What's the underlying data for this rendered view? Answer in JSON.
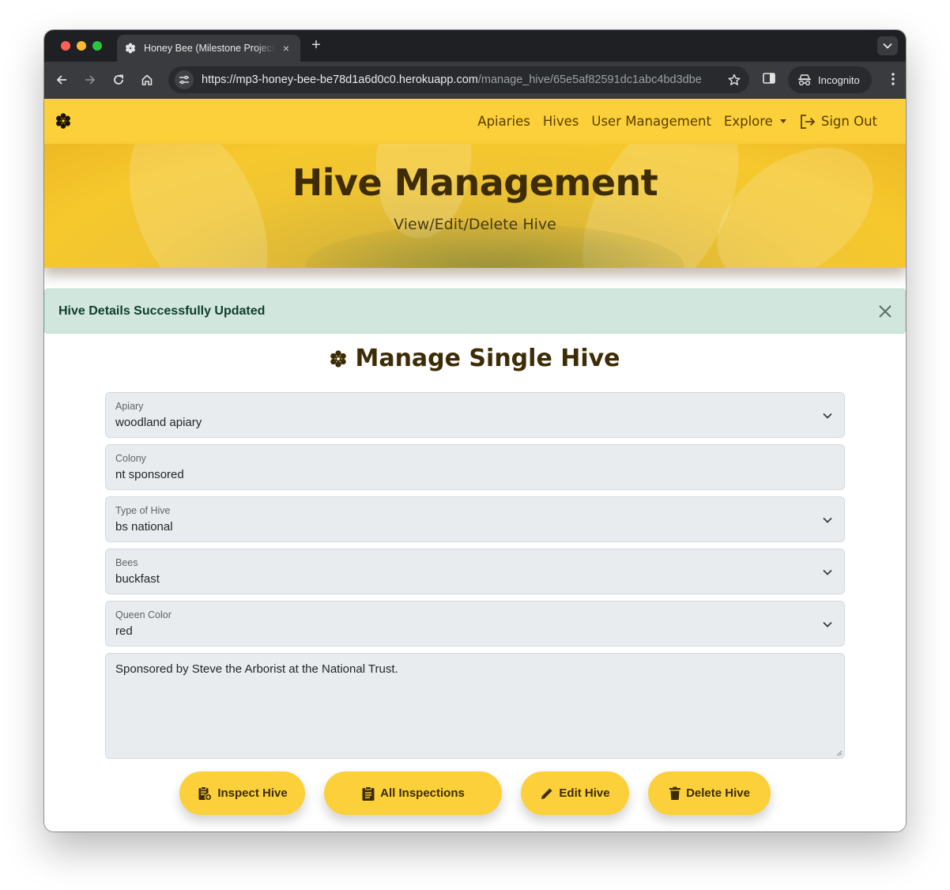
{
  "browser": {
    "tab_title": "Honey Bee (Milestone Project 3)",
    "tab_close": "×",
    "new_tab": "+",
    "url_host": "https://mp3-honey-bee-be78d1a6d0c0.herokuapp.com",
    "url_path": "/manage_hive/65e5af82591dc1abc4bd3dbe",
    "incognito_label": "Incognito"
  },
  "navbar": {
    "links": [
      "Apiaries",
      "Hives",
      "User Management",
      "Explore",
      "Sign Out"
    ]
  },
  "hero": {
    "title": "Hive Management",
    "subtitle": "View/Edit/Delete Hive"
  },
  "alert": {
    "message": "Hive Details Successfully Updated"
  },
  "form": {
    "heading": "Manage Single Hive",
    "apiary": {
      "label": "Apiary",
      "value": "woodland apiary"
    },
    "colony": {
      "label": "Colony",
      "value": "nt sponsored"
    },
    "hive_type": {
      "label": "Type of Hive",
      "value": "bs national"
    },
    "bees": {
      "label": "Bees",
      "value": "buckfast"
    },
    "queen_color": {
      "label": "Queen Color",
      "value": "red"
    },
    "notes": "Sponsored by Steve the Arborist at the National Trust."
  },
  "actions": {
    "inspect": "Inspect Hive",
    "all_inspections": "All Inspections",
    "edit": "Edit Hive",
    "delete": "Delete Hive"
  },
  "colors": {
    "brand_yellow": "#fbd03a",
    "brand_brown": "#3d2c05",
    "alert_bg": "#d1e7dd",
    "field_bg": "#e9ecef"
  },
  "icons": [
    "bee-logo-icon",
    "sign-out-icon",
    "chevron-down-icon",
    "close-icon",
    "clipboard-plus-icon",
    "clipboard-list-icon",
    "pencil-icon",
    "trash-icon"
  ]
}
